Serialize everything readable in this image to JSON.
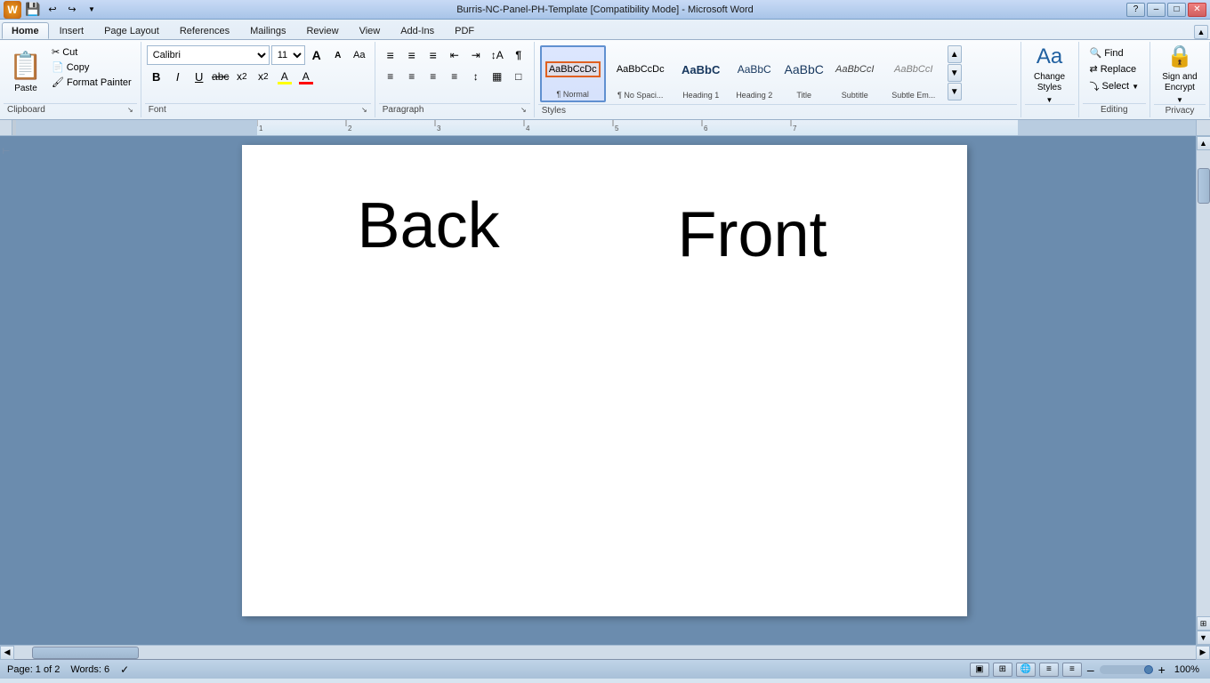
{
  "titleBar": {
    "title": "Burris-NC-Panel-PH-Template [Compatibility Mode] - Microsoft Word",
    "minBtn": "–",
    "maxBtn": "□",
    "closeBtn": "✕"
  },
  "quickAccess": {
    "saveLabel": "💾",
    "undoLabel": "↩",
    "redoLabel": "↪",
    "dropdownLabel": "▼",
    "officeBtn": "⊙"
  },
  "ribbon": {
    "tabs": [
      {
        "id": "home",
        "label": "Home",
        "active": true
      },
      {
        "id": "insert",
        "label": "Insert",
        "active": false
      },
      {
        "id": "pagelayout",
        "label": "Page Layout",
        "active": false
      },
      {
        "id": "references",
        "label": "References",
        "active": false
      },
      {
        "id": "mailings",
        "label": "Mailings",
        "active": false
      },
      {
        "id": "review",
        "label": "Review",
        "active": false
      },
      {
        "id": "view",
        "label": "View",
        "active": false
      },
      {
        "id": "addins",
        "label": "Add-Ins",
        "active": false
      },
      {
        "id": "pdf",
        "label": "PDF",
        "active": false
      }
    ],
    "groups": {
      "clipboard": {
        "label": "Clipboard",
        "pasteLabel": "Paste",
        "pasteIcon": "📋",
        "cutLabel": "Cut",
        "cutIcon": "✂",
        "copyLabel": "Copy",
        "copyIcon": "📄",
        "formatPainterLabel": "Format Painter",
        "formatPainterIcon": "🖌"
      },
      "font": {
        "label": "Font",
        "fontName": "Calibri",
        "fontSize": "11",
        "growIcon": "A",
        "shrinkIcon": "A",
        "clearIcon": "Aa",
        "boldLabel": "B",
        "italicLabel": "I",
        "underlineLabel": "U",
        "strikeLabel": "abc",
        "subLabel": "x₂",
        "supLabel": "x²",
        "highlightLabel": "A",
        "colorLabel": "A"
      },
      "paragraph": {
        "label": "Paragraph",
        "bulletIcon": "≡",
        "numberedIcon": "≡",
        "multiLevelIcon": "≡",
        "decreaseIndentIcon": "←",
        "increaseIndentIcon": "→",
        "sortIcon": "↕",
        "showHideIcon": "¶",
        "alignLeftIcon": "≡",
        "alignCenterIcon": "≡",
        "alignRightIcon": "≡",
        "justifyIcon": "≡",
        "lineSpacingIcon": "↕",
        "shadingIcon": "▦",
        "borderIcon": "□"
      },
      "styles": {
        "label": "Styles",
        "items": [
          {
            "id": "normal",
            "label": "¶ Normal",
            "active": true,
            "preview": "AaBbCcDc"
          },
          {
            "id": "nospacing",
            "label": "¶ No Spaci...",
            "active": false,
            "preview": "AaBbCcDc"
          },
          {
            "id": "heading1",
            "label": "Heading 1",
            "active": false,
            "preview": "AaBbC"
          },
          {
            "id": "heading2",
            "label": "Heading 2",
            "active": false,
            "preview": "AaBbC"
          },
          {
            "id": "title",
            "label": "Title",
            "active": false,
            "preview": "AaBbC"
          },
          {
            "id": "subtitle",
            "label": "Subtitle",
            "active": false,
            "preview": "AaBbCcI"
          },
          {
            "id": "subtleemph",
            "label": "Subtle Em...",
            "active": false,
            "preview": "AaBbCcI"
          }
        ]
      },
      "changeStyles": {
        "label": "Change Styles",
        "icon": "Aa",
        "arrowIcon": "▼"
      },
      "editing": {
        "label": "Editing",
        "findLabel": "Find",
        "findIcon": "🔍",
        "replaceLabel": "Replace",
        "replaceIcon": "⇄",
        "selectLabel": "Select",
        "selectArrow": "▼",
        "selectIcon": "⤵"
      },
      "privacy": {
        "label": "Privacy",
        "signEncryptLabel": "Sign and\nEncrypt",
        "signEncryptIcon": "🔒",
        "arrowIcon": "▼"
      }
    }
  },
  "ruler": {
    "leftMarginWidth": 275
  },
  "document": {
    "textBack": "Back",
    "textFront": "Front"
  },
  "statusBar": {
    "pageInfo": "Page: 1 of 2",
    "wordCount": "Words: 6",
    "langIcon": "✓",
    "zoomLevel": "100%",
    "zoomMinus": "–",
    "zoomPlus": "+"
  }
}
